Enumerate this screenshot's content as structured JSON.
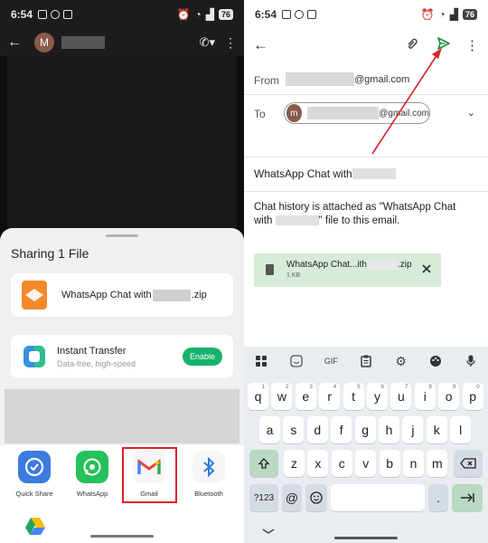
{
  "left_phone": {
    "status": {
      "time": "6:54",
      "battery": "76"
    },
    "chat": {
      "avatar_letter": "M"
    },
    "share_sheet": {
      "title": "Sharing 1 File",
      "file": {
        "name_prefix": "WhatsApp Chat with ",
        "name_suffix": ".zip"
      },
      "instant_transfer": {
        "title": "Instant Transfer",
        "subtitle": "Data-free, high-speed",
        "button": "Enable"
      },
      "apps": [
        {
          "label": "Quick Share",
          "icon": "quick-share-icon"
        },
        {
          "label": "WhatsApp",
          "icon": "whatsapp-icon"
        },
        {
          "label": "Gmail",
          "icon": "gmail-icon"
        },
        {
          "label": "Bluetooth",
          "icon": "bluetooth-icon"
        }
      ]
    }
  },
  "right_phone": {
    "status": {
      "time": "6:54",
      "battery": "76"
    },
    "compose": {
      "from_label": "From",
      "from_domain": "@gmail.com",
      "to_label": "To",
      "to_avatar_letter": "m",
      "to_domain": "@gmail.com",
      "subject_prefix": "WhatsApp Chat with",
      "body_line1": "Chat history is attached as \"WhatsApp Chat",
      "body_line2_prefix": "with",
      "body_line2_suffix": "\" file to this email.",
      "attachment": {
        "name_prefix": "WhatsApp Chat...ith",
        "name_suffix": ".zip",
        "size": "1 KB"
      }
    },
    "keyboard": {
      "toolbar": [
        "apps-grid-icon",
        "sticker-icon",
        "GIF",
        "clipboard-icon",
        "gear-icon",
        "palette-icon",
        "mic-icon"
      ],
      "row1": [
        {
          "k": "q",
          "n": "1"
        },
        {
          "k": "w",
          "n": "2"
        },
        {
          "k": "e",
          "n": "3"
        },
        {
          "k": "r",
          "n": "4"
        },
        {
          "k": "t",
          "n": "5"
        },
        {
          "k": "y",
          "n": "6"
        },
        {
          "k": "u",
          "n": "7"
        },
        {
          "k": "i",
          "n": "8"
        },
        {
          "k": "o",
          "n": "9"
        },
        {
          "k": "p",
          "n": "0"
        }
      ],
      "row2": [
        "a",
        "s",
        "d",
        "f",
        "g",
        "h",
        "j",
        "k",
        "l"
      ],
      "row3": [
        "z",
        "x",
        "c",
        "v",
        "b",
        "n",
        "m"
      ],
      "symbols_key": "?123",
      "at_key": "@",
      "comma_key": ",",
      "period_key": "."
    }
  },
  "colors": {
    "gmail_highlight": "#d8232a",
    "enable_green": "#17b26a",
    "send_green": "#1e8e3e",
    "arrow_red": "#d8232a",
    "attachment_bg": "#d6ecd9"
  }
}
